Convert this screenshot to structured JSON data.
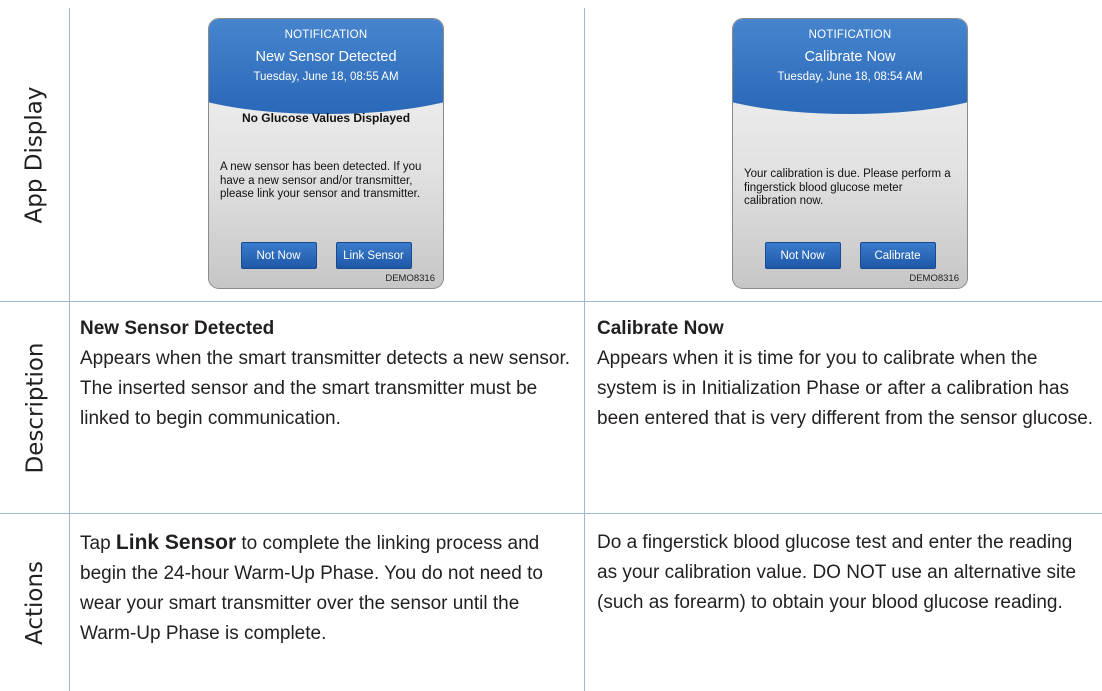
{
  "rows": {
    "app_display": "App Display",
    "description": "Description",
    "actions": "Actions"
  },
  "screens": [
    {
      "label": "NOTIFICATION",
      "title": "New Sensor Detected",
      "datetime": "Tuesday, June 18, 08:55 AM",
      "headline": "No Glucose Values Displayed",
      "message": "A new sensor has been detected. If you have a new sensor and/or transmitter, please link your sensor and transmitter.",
      "btn_left": "Not Now",
      "btn_right": "Link Sensor",
      "code": "DEMO8316"
    },
    {
      "label": "NOTIFICATION",
      "title": "Calibrate Now",
      "datetime": "Tuesday, June 18, 08:54 AM",
      "headline": "",
      "message": "Your calibration is due. Please perform a fingerstick blood glucose meter calibration now.",
      "btn_left": "Not Now",
      "btn_right": "Calibrate",
      "code": "DEMO8316"
    }
  ],
  "descriptions": [
    {
      "title": "New Sensor Detected",
      "text": "Appears when the smart transmitter detects a new sensor. The inserted sensor and the smart transmitter must be linked to begin communication."
    },
    {
      "title": "Calibrate Now",
      "text": "Appears when it is time for you to calibrate when the system is in Initialization Phase or after a calibration has been entered that is very different from the sensor glucose."
    }
  ],
  "actions": [
    {
      "prefix": "Tap ",
      "bold": "Link Sensor",
      "text": " to complete the linking process and begin the 24-hour Warm-Up Phase. You do not need to wear your smart transmitter over the sensor until the Warm-Up Phase is complete."
    },
    {
      "text": "Do a fingerstick blood glucose test and enter the reading as your calibration value. DO NOT use an alternative site (such as forearm) to obtain your blood glucose reading."
    }
  ]
}
